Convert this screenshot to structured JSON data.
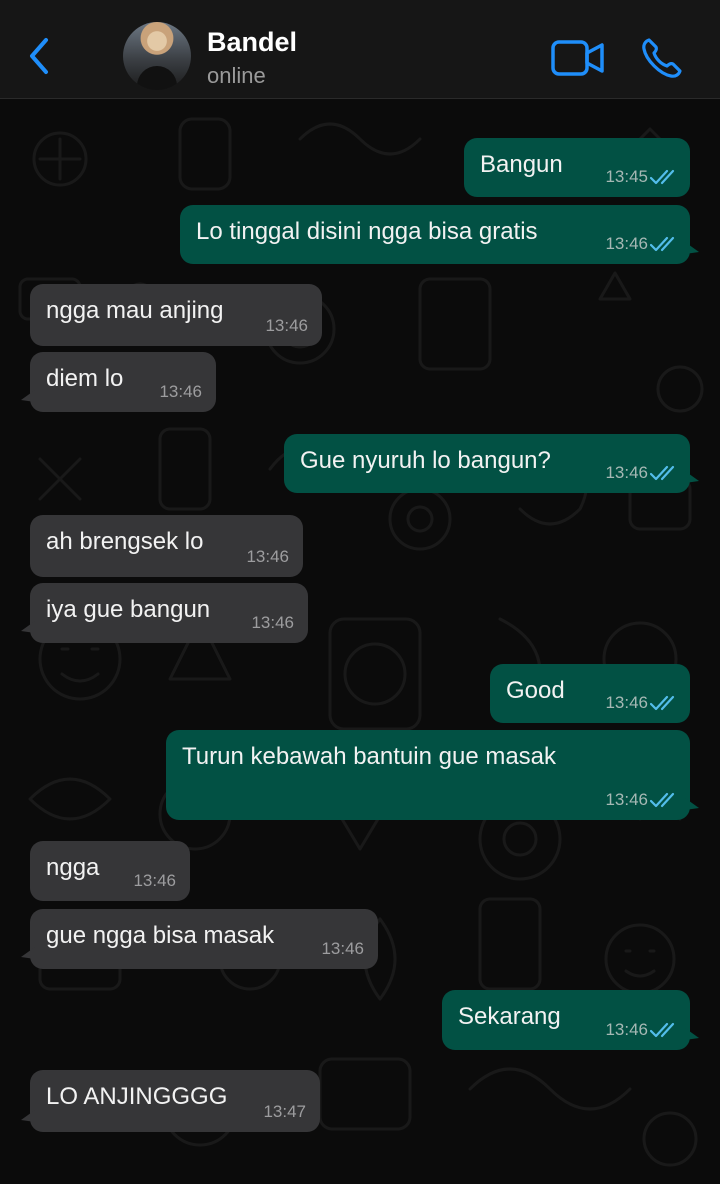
{
  "header": {
    "contact_name": "Bandel",
    "status": "online"
  },
  "colors": {
    "accent": "#1f8efa",
    "outgoing_bubble": "#025144",
    "incoming_bubble": "#363638",
    "read_ticks": "#53bdeb"
  },
  "icons": {
    "back": "chevron-left-icon",
    "video": "video-camera-icon",
    "call": "phone-icon",
    "read_receipt": "double-check-icon"
  },
  "messages": [
    {
      "direction": "out",
      "text": "Bangun",
      "time": "13:45"
    },
    {
      "direction": "out",
      "text": "Lo tinggal disini ngga bisa gratis",
      "time": "13:46"
    },
    {
      "direction": "in",
      "text": "ngga mau anjing",
      "time": "13:46"
    },
    {
      "direction": "in",
      "text": "diem lo",
      "time": "13:46"
    },
    {
      "direction": "out",
      "text": "Gue nyuruh lo bangun?",
      "time": "13:46"
    },
    {
      "direction": "in",
      "text": "ah brengsek lo",
      "time": "13:46"
    },
    {
      "direction": "in",
      "text": "iya gue bangun",
      "time": "13:46"
    },
    {
      "direction": "out",
      "text": "Good",
      "time": "13:46"
    },
    {
      "direction": "out",
      "text": "Turun kebawah bantuin gue masak",
      "time": "13:46"
    },
    {
      "direction": "in",
      "text": "ngga",
      "time": "13:46"
    },
    {
      "direction": "in",
      "text": "gue ngga bisa masak",
      "time": "13:46"
    },
    {
      "direction": "out",
      "text": "Sekarang",
      "time": "13:46"
    },
    {
      "direction": "in",
      "text": "LO ANJINGGGG",
      "time": "13:47"
    }
  ]
}
